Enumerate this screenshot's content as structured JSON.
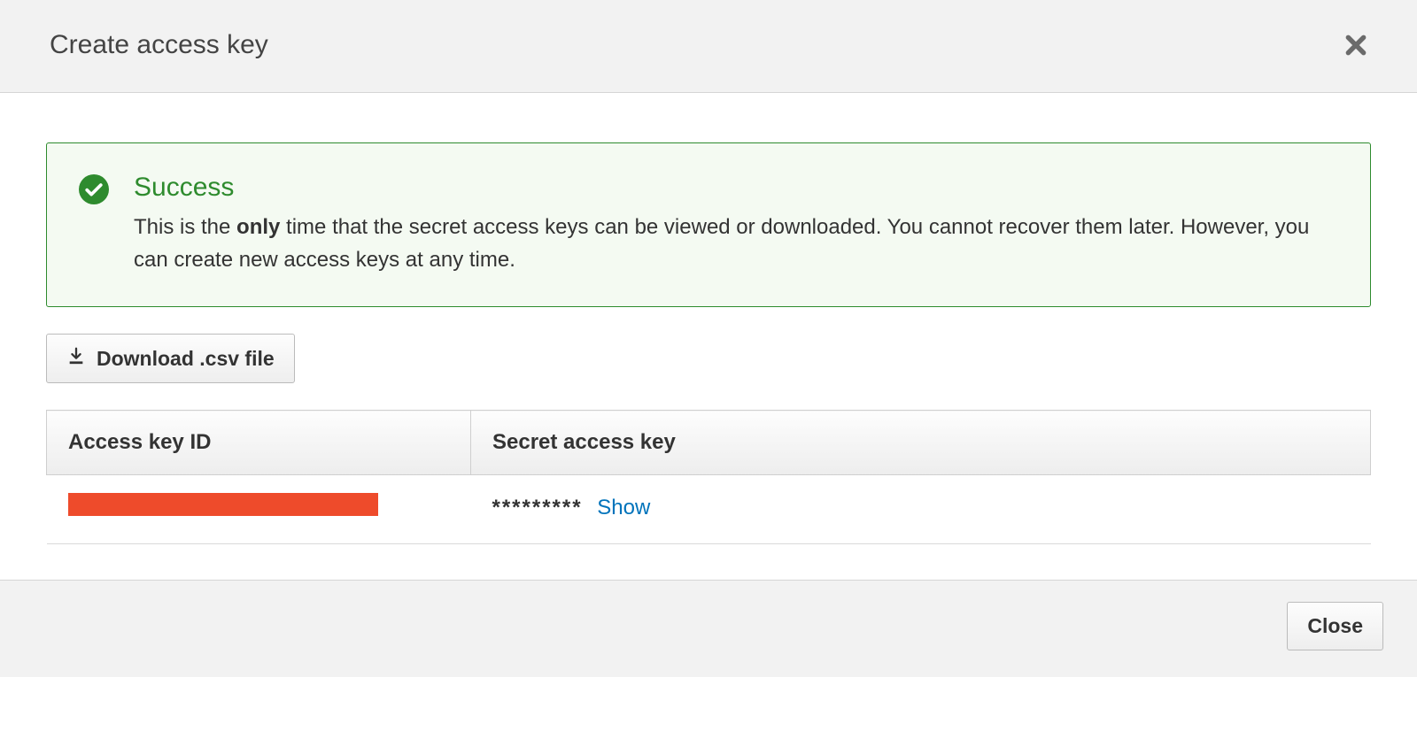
{
  "header": {
    "title": "Create access key"
  },
  "alert": {
    "title": "Success",
    "desc_pre": "This is the ",
    "desc_bold": "only",
    "desc_post": " time that the secret access keys can be viewed or downloaded. You cannot recover them later. However, you can create new access keys at any time."
  },
  "toolbar": {
    "download_label": "Download .csv file"
  },
  "table": {
    "col_access_key_id": "Access key ID",
    "col_secret": "Secret access key",
    "row": {
      "secret_masked": "*********",
      "show_label": "Show"
    }
  },
  "footer": {
    "close_label": "Close"
  }
}
